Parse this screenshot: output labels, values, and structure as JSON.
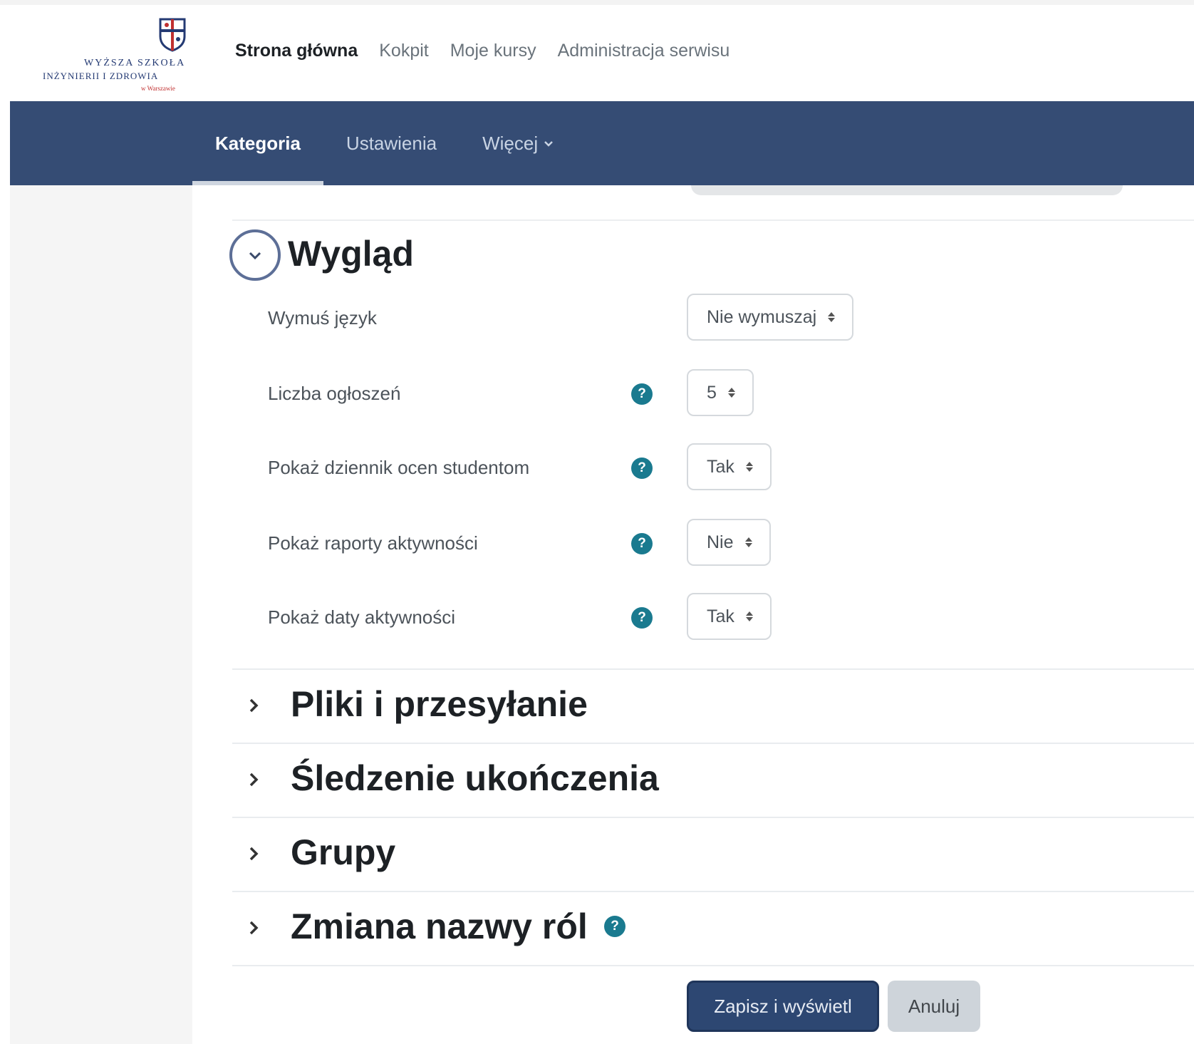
{
  "header": {
    "logo": {
      "line1": "WYŻSZA SZKOŁA",
      "line2": "INŻYNIERII I ZDROWIA",
      "line3": "w Warszawie"
    },
    "nav": [
      {
        "label": "Strona główna",
        "active": true
      },
      {
        "label": "Kokpit",
        "active": false
      },
      {
        "label": "Moje kursy",
        "active": false
      },
      {
        "label": "Administracja serwisu",
        "active": false
      }
    ]
  },
  "secondary_nav": {
    "tabs": [
      {
        "label": "Kategoria",
        "active": true
      },
      {
        "label": "Ustawienia",
        "active": false
      },
      {
        "label": "Więcej",
        "active": false,
        "icon": "chevron-down-icon"
      }
    ]
  },
  "appearance": {
    "title": "Wygląd",
    "expanded": true,
    "fields": [
      {
        "label": "Wymuś język",
        "value": "Nie wymuszaj",
        "help": false
      },
      {
        "label": "Liczba ogłoszeń",
        "value": "5",
        "help": true
      },
      {
        "label": "Pokaż dziennik ocen studentom",
        "value": "Tak",
        "help": true
      },
      {
        "label": "Pokaż raporty aktywności",
        "value": "Nie",
        "help": true
      },
      {
        "label": "Pokaż daty aktywności",
        "value": "Tak",
        "help": true
      }
    ]
  },
  "collapsed_sections": [
    {
      "title": "Pliki i przesyłanie",
      "help": false
    },
    {
      "title": "Śledzenie ukończenia",
      "help": false
    },
    {
      "title": "Grupy",
      "help": false
    },
    {
      "title": "Zmiana nazwy ról",
      "help": true
    }
  ],
  "buttons": {
    "save": "Zapisz i wyświetl",
    "cancel": "Anuluj"
  },
  "icons": {
    "help_glyph": "?"
  },
  "colors": {
    "nav_bar": "#354c74",
    "help_icon": "#1a7a8f",
    "primary_button": "#2d4772"
  }
}
